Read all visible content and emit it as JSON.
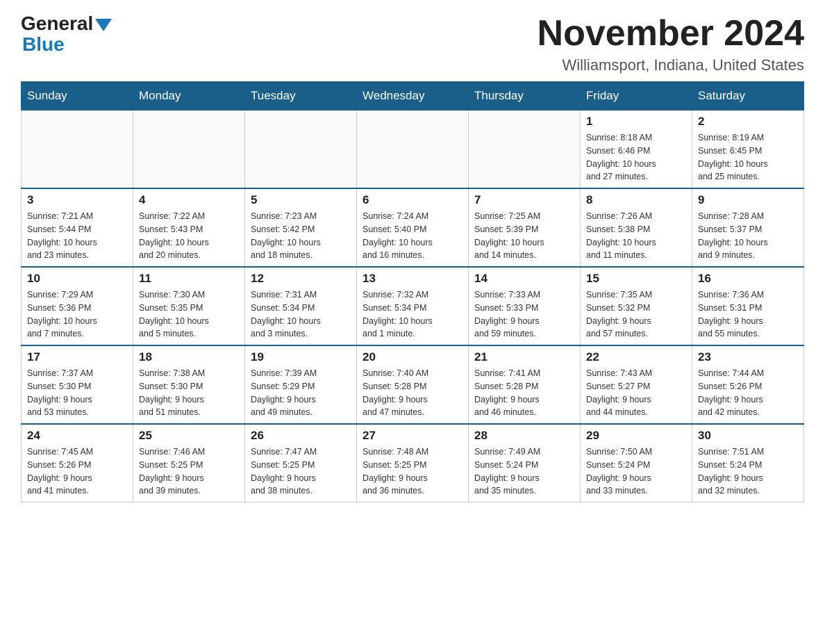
{
  "header": {
    "logo_general": "General",
    "logo_blue": "Blue",
    "month_title": "November 2024",
    "location": "Williamsport, Indiana, United States"
  },
  "calendar": {
    "days_of_week": [
      "Sunday",
      "Monday",
      "Tuesday",
      "Wednesday",
      "Thursday",
      "Friday",
      "Saturday"
    ],
    "weeks": [
      [
        {
          "num": "",
          "info": ""
        },
        {
          "num": "",
          "info": ""
        },
        {
          "num": "",
          "info": ""
        },
        {
          "num": "",
          "info": ""
        },
        {
          "num": "",
          "info": ""
        },
        {
          "num": "1",
          "info": "Sunrise: 8:18 AM\nSunset: 6:46 PM\nDaylight: 10 hours\nand 27 minutes."
        },
        {
          "num": "2",
          "info": "Sunrise: 8:19 AM\nSunset: 6:45 PM\nDaylight: 10 hours\nand 25 minutes."
        }
      ],
      [
        {
          "num": "3",
          "info": "Sunrise: 7:21 AM\nSunset: 5:44 PM\nDaylight: 10 hours\nand 23 minutes."
        },
        {
          "num": "4",
          "info": "Sunrise: 7:22 AM\nSunset: 5:43 PM\nDaylight: 10 hours\nand 20 minutes."
        },
        {
          "num": "5",
          "info": "Sunrise: 7:23 AM\nSunset: 5:42 PM\nDaylight: 10 hours\nand 18 minutes."
        },
        {
          "num": "6",
          "info": "Sunrise: 7:24 AM\nSunset: 5:40 PM\nDaylight: 10 hours\nand 16 minutes."
        },
        {
          "num": "7",
          "info": "Sunrise: 7:25 AM\nSunset: 5:39 PM\nDaylight: 10 hours\nand 14 minutes."
        },
        {
          "num": "8",
          "info": "Sunrise: 7:26 AM\nSunset: 5:38 PM\nDaylight: 10 hours\nand 11 minutes."
        },
        {
          "num": "9",
          "info": "Sunrise: 7:28 AM\nSunset: 5:37 PM\nDaylight: 10 hours\nand 9 minutes."
        }
      ],
      [
        {
          "num": "10",
          "info": "Sunrise: 7:29 AM\nSunset: 5:36 PM\nDaylight: 10 hours\nand 7 minutes."
        },
        {
          "num": "11",
          "info": "Sunrise: 7:30 AM\nSunset: 5:35 PM\nDaylight: 10 hours\nand 5 minutes."
        },
        {
          "num": "12",
          "info": "Sunrise: 7:31 AM\nSunset: 5:34 PM\nDaylight: 10 hours\nand 3 minutes."
        },
        {
          "num": "13",
          "info": "Sunrise: 7:32 AM\nSunset: 5:34 PM\nDaylight: 10 hours\nand 1 minute."
        },
        {
          "num": "14",
          "info": "Sunrise: 7:33 AM\nSunset: 5:33 PM\nDaylight: 9 hours\nand 59 minutes."
        },
        {
          "num": "15",
          "info": "Sunrise: 7:35 AM\nSunset: 5:32 PM\nDaylight: 9 hours\nand 57 minutes."
        },
        {
          "num": "16",
          "info": "Sunrise: 7:36 AM\nSunset: 5:31 PM\nDaylight: 9 hours\nand 55 minutes."
        }
      ],
      [
        {
          "num": "17",
          "info": "Sunrise: 7:37 AM\nSunset: 5:30 PM\nDaylight: 9 hours\nand 53 minutes."
        },
        {
          "num": "18",
          "info": "Sunrise: 7:38 AM\nSunset: 5:30 PM\nDaylight: 9 hours\nand 51 minutes."
        },
        {
          "num": "19",
          "info": "Sunrise: 7:39 AM\nSunset: 5:29 PM\nDaylight: 9 hours\nand 49 minutes."
        },
        {
          "num": "20",
          "info": "Sunrise: 7:40 AM\nSunset: 5:28 PM\nDaylight: 9 hours\nand 47 minutes."
        },
        {
          "num": "21",
          "info": "Sunrise: 7:41 AM\nSunset: 5:28 PM\nDaylight: 9 hours\nand 46 minutes."
        },
        {
          "num": "22",
          "info": "Sunrise: 7:43 AM\nSunset: 5:27 PM\nDaylight: 9 hours\nand 44 minutes."
        },
        {
          "num": "23",
          "info": "Sunrise: 7:44 AM\nSunset: 5:26 PM\nDaylight: 9 hours\nand 42 minutes."
        }
      ],
      [
        {
          "num": "24",
          "info": "Sunrise: 7:45 AM\nSunset: 5:26 PM\nDaylight: 9 hours\nand 41 minutes."
        },
        {
          "num": "25",
          "info": "Sunrise: 7:46 AM\nSunset: 5:25 PM\nDaylight: 9 hours\nand 39 minutes."
        },
        {
          "num": "26",
          "info": "Sunrise: 7:47 AM\nSunset: 5:25 PM\nDaylight: 9 hours\nand 38 minutes."
        },
        {
          "num": "27",
          "info": "Sunrise: 7:48 AM\nSunset: 5:25 PM\nDaylight: 9 hours\nand 36 minutes."
        },
        {
          "num": "28",
          "info": "Sunrise: 7:49 AM\nSunset: 5:24 PM\nDaylight: 9 hours\nand 35 minutes."
        },
        {
          "num": "29",
          "info": "Sunrise: 7:50 AM\nSunset: 5:24 PM\nDaylight: 9 hours\nand 33 minutes."
        },
        {
          "num": "30",
          "info": "Sunrise: 7:51 AM\nSunset: 5:24 PM\nDaylight: 9 hours\nand 32 minutes."
        }
      ]
    ]
  }
}
